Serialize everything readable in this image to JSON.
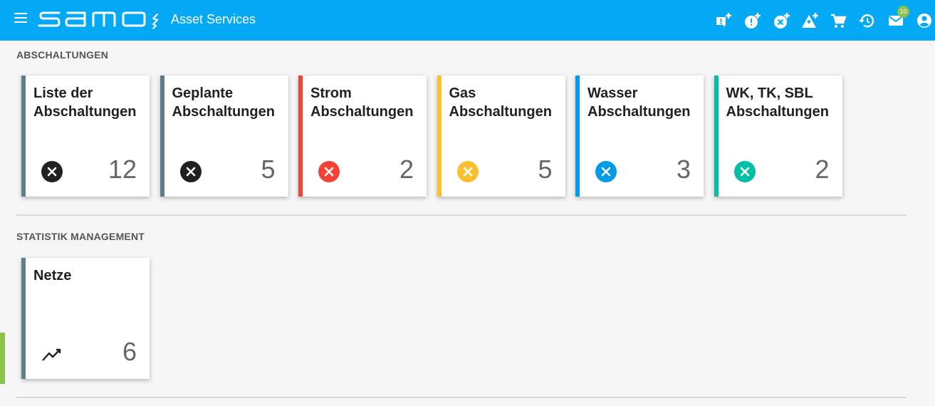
{
  "header": {
    "app_title": "Asset Services",
    "logo_text": "samo",
    "notification_count": "10",
    "icons": [
      "menu-icon",
      "add-notification-icon",
      "add-alert-icon",
      "add-shutdown-icon",
      "add-warning-icon",
      "cart-icon",
      "history-icon",
      "mail-icon",
      "account-icon"
    ],
    "accent_color": "#03a9f4"
  },
  "sections": [
    {
      "title": "ABSCHALTUNGEN",
      "cards": [
        {
          "line1": "Liste der",
          "line2": "Abschaltungen",
          "count": "12",
          "color": "#607d8b",
          "icon": "cancel-icon",
          "icon_color": "#212121"
        },
        {
          "line1": "Geplante",
          "line2": "Abschaltungen",
          "count": "5",
          "color": "#607d8b",
          "icon": "cancel-icon",
          "icon_color": "#212121"
        },
        {
          "line1": "Strom",
          "line2": "Abschaltungen",
          "count": "2",
          "color": "#f44336",
          "icon": "cancel-icon",
          "icon_color": "#f44336"
        },
        {
          "line1": "Gas",
          "line2": "Abschaltungen",
          "count": "5",
          "color": "#fbc02d",
          "icon": "cancel-icon",
          "icon_color": "#fbc02d"
        },
        {
          "line1": "Wasser",
          "line2": "Abschaltungen",
          "count": "3",
          "color": "#039be5",
          "icon": "cancel-icon",
          "icon_color": "#039be5"
        },
        {
          "line1": "WK, TK, SBL",
          "line2": "Abschaltungen",
          "count": "2",
          "color": "#00bfa5",
          "icon": "cancel-icon",
          "icon_color": "#00bfa5"
        }
      ]
    },
    {
      "title": "STATISTIK MANAGEMENT",
      "cards": [
        {
          "line1": "Netze",
          "line2": "",
          "count": "6",
          "color": "#607d8b",
          "icon": "trending-line-icon",
          "icon_color": "#212121"
        }
      ]
    }
  ]
}
